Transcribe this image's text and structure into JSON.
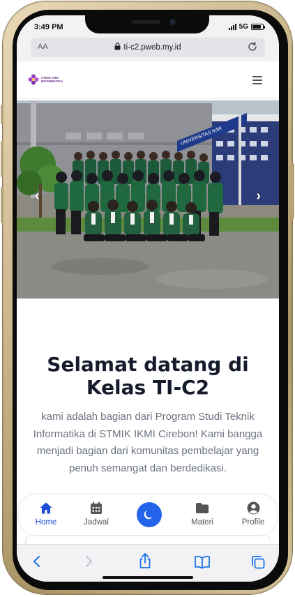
{
  "status_bar": {
    "time": "3:49 PM",
    "network": "5G",
    "battery_level": 0.85
  },
  "browser": {
    "text_size_label": "AA",
    "url": "ti-c2.pweb.my.id"
  },
  "site": {
    "logo_text_line1": "STMIK IKMI",
    "logo_text_line2": "INFORMATIKA",
    "carousel_prev": "‹",
    "carousel_next": "›",
    "hero_banner_text": "UNIVERSITAS IKMI"
  },
  "main": {
    "title": "Selamat datang di Kelas TI-C2",
    "intro": "kami adalah bagian dari Program Studi Teknik Informatika di STMIK IKMI Cirebon! Kami bangga menjadi bagian dari komunitas pembelajar yang penuh semangat dan berdedikasi."
  },
  "bottom_nav": {
    "items": [
      {
        "label": "Home",
        "icon": "home-icon",
        "active": true
      },
      {
        "label": "Jadwal",
        "icon": "calendar-icon",
        "active": false
      },
      {
        "label": "Materi",
        "icon": "folder-icon",
        "active": false
      },
      {
        "label": "Profile",
        "icon": "user-circle-icon",
        "active": false
      }
    ],
    "center_icon": "moon-icon"
  },
  "colors": {
    "accent": "#2563eb",
    "active_label": "#1d4ed8",
    "heading": "#161b2b",
    "body_text": "#6b7280",
    "toolbar_blue": "#1a73e8"
  }
}
